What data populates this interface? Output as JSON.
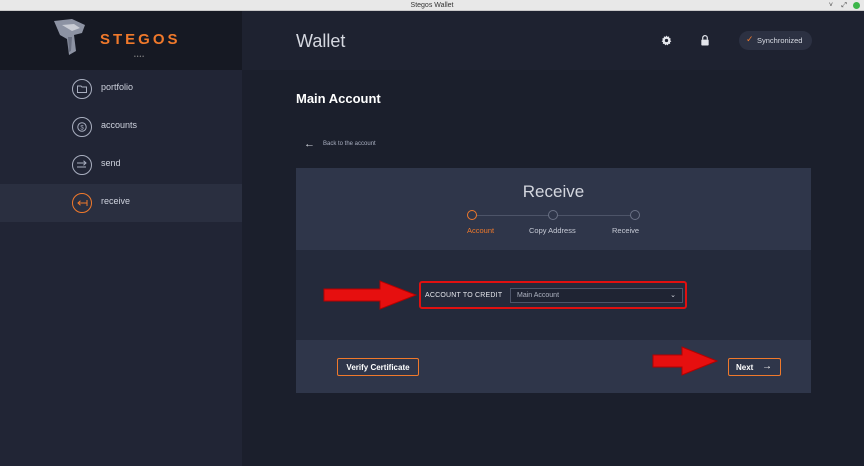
{
  "window": {
    "title": "Stegos Wallet",
    "controls": [
      "˅",
      "⤢"
    ]
  },
  "brand": {
    "name": "STEGOS",
    "sub": "••••"
  },
  "sidebar": {
    "items": [
      {
        "label": "portfolio",
        "icon": "folder-icon"
      },
      {
        "label": "accounts",
        "icon": "coin-icon"
      },
      {
        "label": "send",
        "icon": "send-icon"
      },
      {
        "label": "receive",
        "icon": "receive-icon",
        "active": true
      }
    ]
  },
  "header": {
    "title": "Wallet",
    "sync_status": "Synchronized",
    "sync_check": "✓"
  },
  "main": {
    "page_title": "Main Account",
    "back_arrow": "←",
    "back_label": "Back to the account",
    "card": {
      "title": "Receive",
      "steps": [
        {
          "label": "Account",
          "active": true
        },
        {
          "label": "Copy Address",
          "active": false
        },
        {
          "label": "Receive",
          "active": false
        }
      ],
      "field_label": "ACCOUNT TO CREDIT",
      "field_value": "Main Account",
      "field_caret": "⌄",
      "verify_label": "Verify Certificate",
      "next_label": "Next",
      "next_arrow": "→"
    }
  },
  "colors": {
    "accent": "#f0792b",
    "highlight": "#e01010",
    "background": "#1b1f2c"
  }
}
